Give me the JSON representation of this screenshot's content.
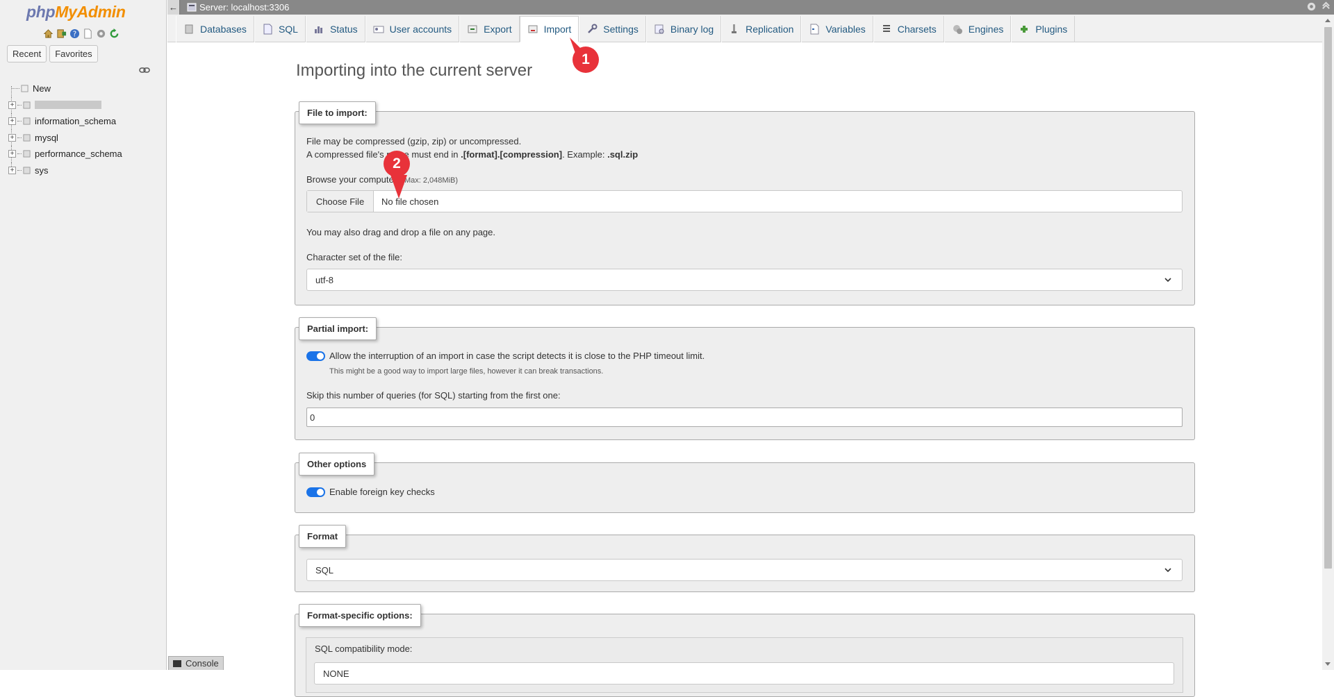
{
  "sidebar": {
    "logo_part1": "php",
    "logo_part2": "MyAdmin",
    "tabs": {
      "recent": "Recent",
      "favorites": "Favorites"
    },
    "tree": {
      "new_label": "New",
      "databases": [
        "information_schema",
        "mysql",
        "performance_schema",
        "sys"
      ]
    }
  },
  "topbar": {
    "server": "Server: localhost:3306"
  },
  "tabs": [
    {
      "label": "Databases",
      "icon": "databases-icon"
    },
    {
      "label": "SQL",
      "icon": "sql-icon"
    },
    {
      "label": "Status",
      "icon": "status-icon"
    },
    {
      "label": "User accounts",
      "icon": "user-accounts-icon"
    },
    {
      "label": "Export",
      "icon": "export-icon"
    },
    {
      "label": "Import",
      "icon": "import-icon",
      "active": true
    },
    {
      "label": "Settings",
      "icon": "settings-icon"
    },
    {
      "label": "Binary log",
      "icon": "binary-log-icon"
    },
    {
      "label": "Replication",
      "icon": "replication-icon"
    },
    {
      "label": "Variables",
      "icon": "variables-icon"
    },
    {
      "label": "Charsets",
      "icon": "charsets-icon"
    },
    {
      "label": "Engines",
      "icon": "engines-icon"
    },
    {
      "label": "Plugins",
      "icon": "plugins-icon"
    }
  ],
  "main": {
    "title": "Importing into the current server",
    "file_to_import": {
      "legend": "File to import:",
      "line1": "File may be compressed (gzip, zip) or uncompressed.",
      "line2_pre": "A compressed file's name must end in ",
      "line2_bold": ".[format].[compression]",
      "line2_mid": ". Example: ",
      "line2_example": ".sql.zip",
      "browse": "Browse your computer:",
      "max": "(Max: 2,048MiB)",
      "choose_file": "Choose File",
      "no_file": "No file chosen",
      "drag": "You may also drag and drop a file on any page.",
      "charset_label": "Character set of the file:",
      "charset_value": "utf-8"
    },
    "partial_import": {
      "legend": "Partial import:",
      "allow": "Allow the interruption of an import in case the script detects it is close to the PHP timeout limit.",
      "note": "This might be a good way to import large files, however it can break transactions.",
      "skip_label": "Skip this number of queries (for SQL) starting from the first one:",
      "skip_value": "0"
    },
    "other_options": {
      "legend": "Other options",
      "fk": "Enable foreign key checks"
    },
    "format": {
      "legend": "Format",
      "value": "SQL"
    },
    "format_specific": {
      "legend": "Format-specific options:",
      "compat": "SQL compatibility mode:",
      "compat_value": "NONE"
    }
  },
  "markers": {
    "m1": "1",
    "m2": "2"
  },
  "console": {
    "label": "Console"
  },
  "colors": {
    "accent": "#1a73e8",
    "link": "#235a81",
    "marker": "#e8323a"
  }
}
